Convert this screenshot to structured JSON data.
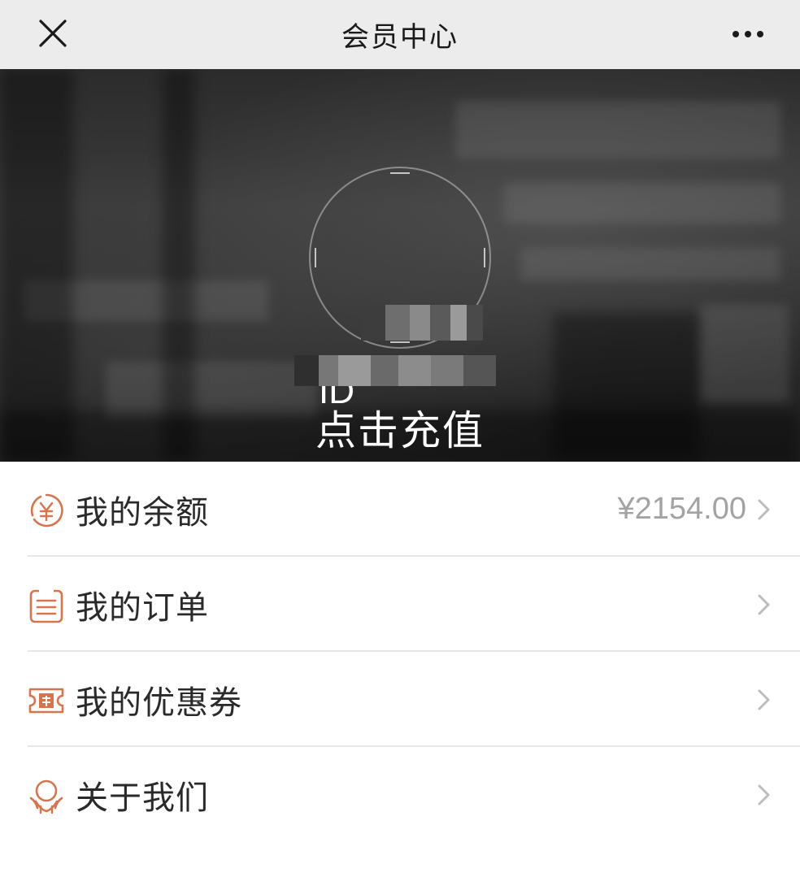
{
  "header": {
    "title": "会员中心",
    "close_icon": "close-icon",
    "more_icon": "more-dots-icon"
  },
  "profile": {
    "id_label": "ID",
    "recharge_label": "点击充值"
  },
  "menu": [
    {
      "label": "我的余额",
      "value": "¥2154.00",
      "icon": "yuan-coin-icon"
    },
    {
      "label": "我的订单",
      "value": "",
      "icon": "order-list-icon"
    },
    {
      "label": "我的优惠券",
      "value": "",
      "icon": "coupon-icon"
    },
    {
      "label": "关于我们",
      "value": "",
      "icon": "handshake-icon"
    }
  ],
  "colors": {
    "accent": "#d9734a",
    "header_bg": "#ececec",
    "chevron": "#bdbdbd"
  }
}
